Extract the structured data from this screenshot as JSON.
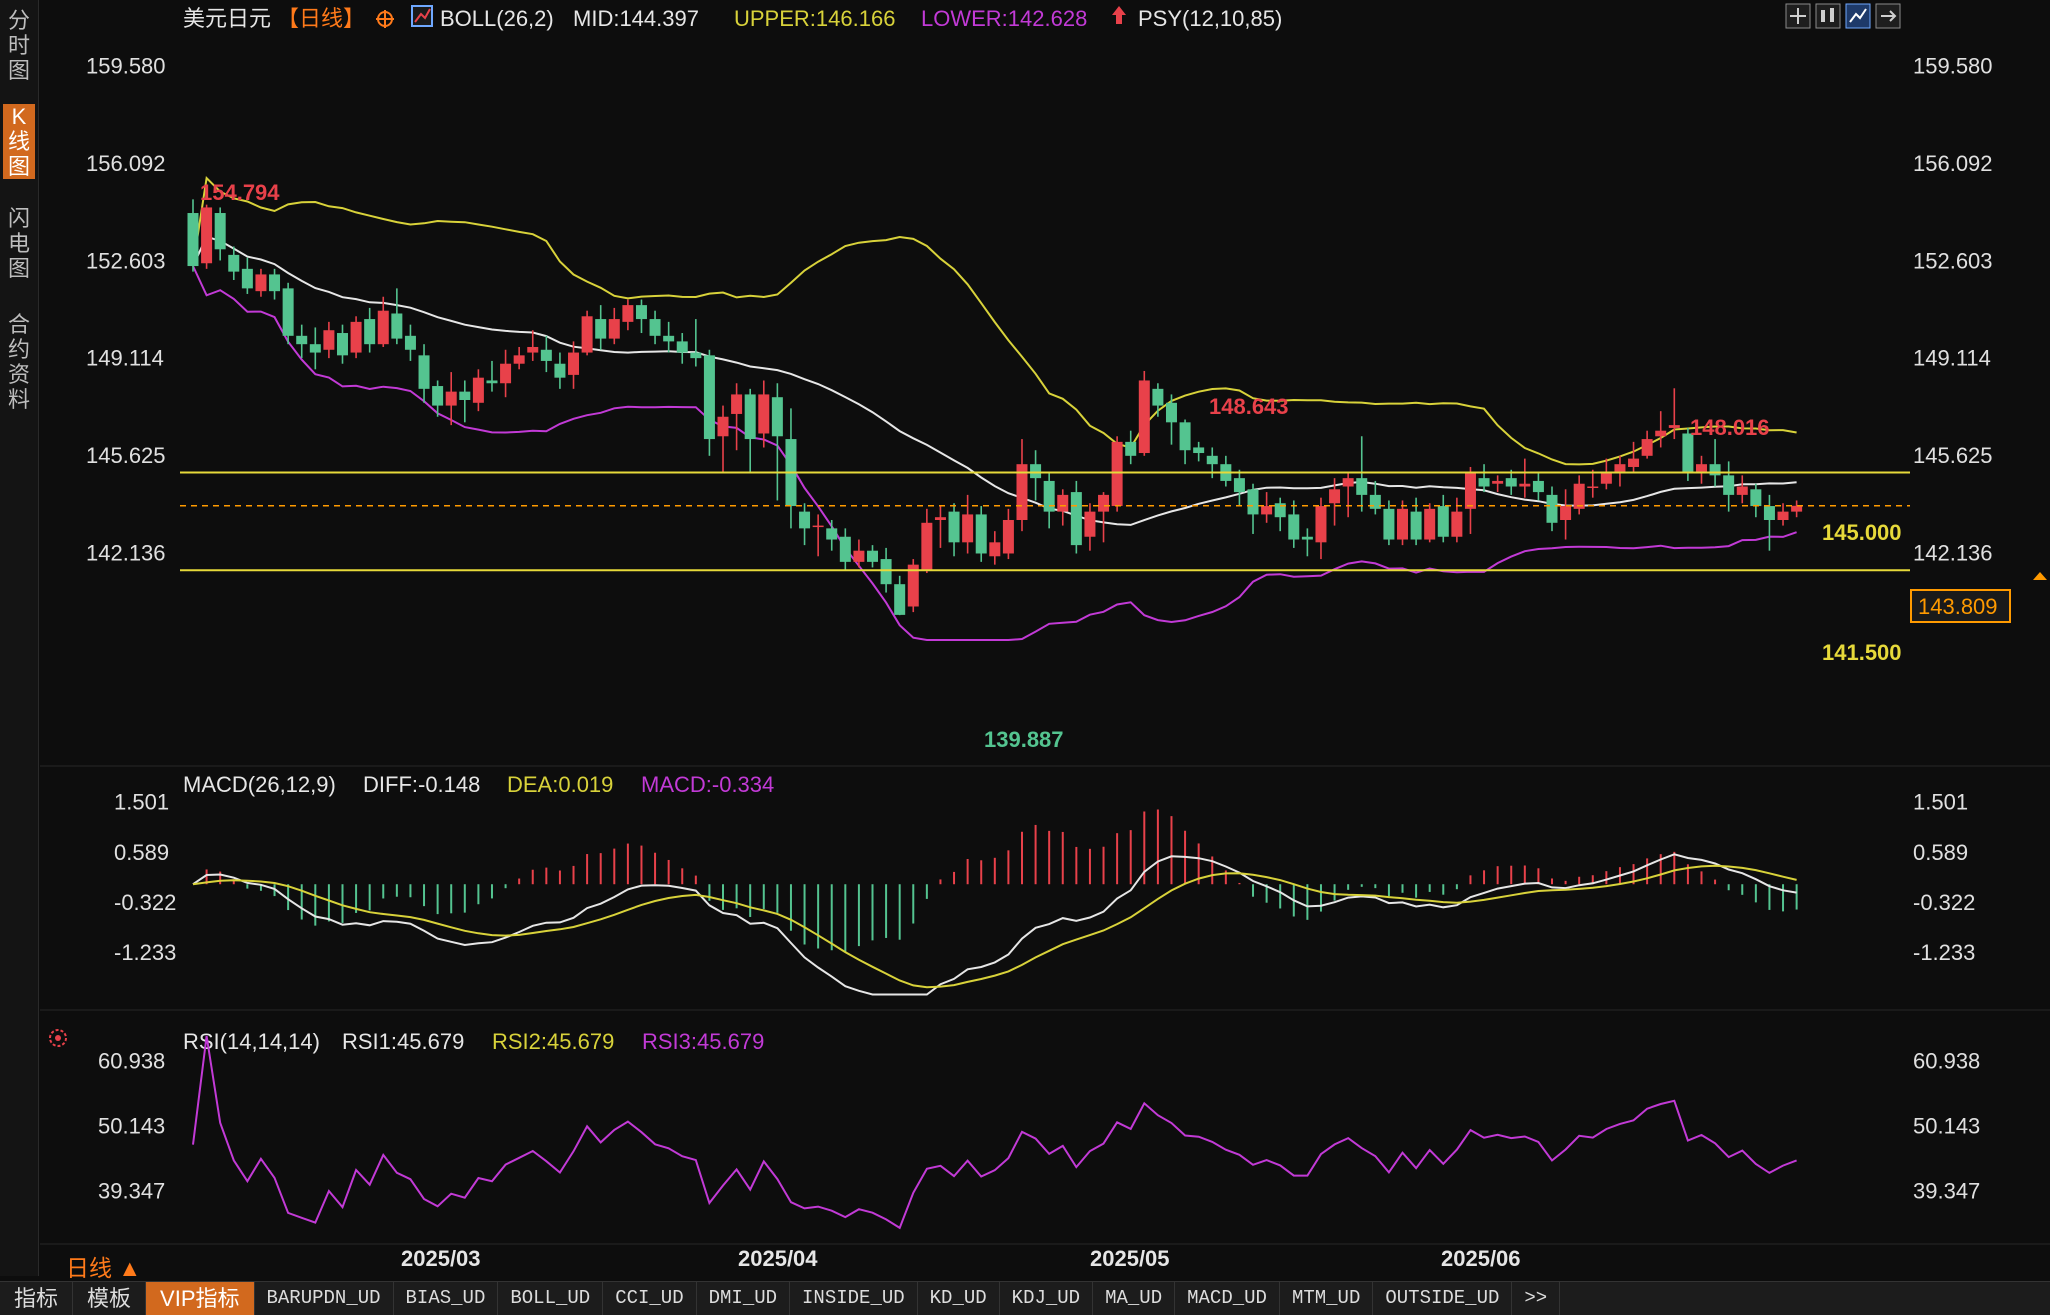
{
  "sidebar": {
    "tabs": [
      {
        "label": "分时图",
        "active": false
      },
      {
        "label": "K线图",
        "active": true
      },
      {
        "label": "闪电图",
        "active": false
      },
      {
        "label": "合约资料",
        "active": false
      }
    ]
  },
  "header": {
    "symbol": "美元日元",
    "period_tag": "【日线】",
    "boll_label": "BOLL(26,2)",
    "mid": "MID:144.397",
    "upper": "UPPER:146.166",
    "lower": "LOWER:142.628",
    "psy": "PSY(12,10,85)"
  },
  "price_axis": {
    "ticks": [
      "159.580",
      "156.092",
      "152.603",
      "149.114",
      "145.625",
      "142.136"
    ],
    "current_price": "143.809"
  },
  "annotations": {
    "high1": "154.794",
    "high2": "148.643",
    "high3": "148.016",
    "low1": "139.887",
    "level_upper": "145.000",
    "level_lower": "141.500"
  },
  "macd": {
    "label": "MACD(26,12,9)",
    "diff": "DIFF:-0.148",
    "dea": "DEA:0.019",
    "macd": "MACD:-0.334",
    "ticks": [
      "1.501",
      "0.589",
      "-0.322",
      "-1.233"
    ]
  },
  "rsi": {
    "label": "RSI(14,14,14)",
    "rsi1": "RSI1:45.679",
    "rsi2": "RSI2:45.679",
    "rsi3": "RSI3:45.679",
    "ticks": [
      "60.938",
      "50.143",
      "39.347"
    ]
  },
  "time_axis": [
    "2025/03",
    "2025/04",
    "2025/05",
    "2025/06"
  ],
  "period_label": "日线 ▲",
  "bottom_tabs": [
    {
      "label": "指标",
      "active": false
    },
    {
      "label": "模板",
      "active": false
    },
    {
      "label": "VIP指标",
      "active": true
    },
    {
      "label": "BARUPDN_UD",
      "active": false
    },
    {
      "label": "BIAS_UD",
      "active": false
    },
    {
      "label": "BOLL_UD",
      "active": false
    },
    {
      "label": "CCI_UD",
      "active": false
    },
    {
      "label": "DMI_UD",
      "active": false
    },
    {
      "label": "INSIDE_UD",
      "active": false
    },
    {
      "label": "KD_UD",
      "active": false
    },
    {
      "label": "KDJ_UD",
      "active": false
    },
    {
      "label": "MA_UD",
      "active": false
    },
    {
      "label": "MACD_UD",
      "active": false
    },
    {
      "label": "MTM_UD",
      "active": false
    },
    {
      "label": "OUTSIDE_UD",
      "active": false
    },
    {
      "label": ">>",
      "active": false
    }
  ],
  "colors": {
    "up": "#e8414a",
    "down": "#54c490",
    "upper_band": "#d8d23a",
    "mid_band": "#e6e6e6",
    "lower_band": "#c23ad6",
    "level_line": "#e6d93a",
    "current_price": "#ff9a00",
    "accent": "#d2691e"
  },
  "chart_data": [
    {
      "type": "candlestick",
      "title": "美元日元 日线",
      "x_ticks": [
        "2025/03",
        "2025/04",
        "2025/05",
        "2025/06"
      ],
      "ylim": [
        139.0,
        160.5
      ],
      "y_ticks": [
        159.58,
        156.092,
        152.603,
        149.114,
        145.625,
        142.136
      ],
      "candles": [
        [
          154.3,
          152.4,
          154.79,
          152.2
        ],
        [
          152.5,
          154.5,
          154.6,
          152.3
        ],
        [
          154.3,
          153.0,
          154.5,
          152.6
        ],
        [
          152.8,
          152.2,
          153.1,
          151.9
        ],
        [
          152.3,
          151.6,
          152.7,
          151.4
        ],
        [
          151.5,
          152.1,
          152.3,
          151.3
        ],
        [
          152.1,
          151.5,
          152.3,
          151.2
        ],
        [
          151.6,
          149.9,
          151.8,
          149.6
        ],
        [
          149.9,
          149.6,
          150.3,
          149.1
        ],
        [
          149.6,
          149.3,
          150.2,
          148.7
        ],
        [
          149.4,
          150.1,
          150.4,
          149.1
        ],
        [
          150.0,
          149.2,
          150.3,
          148.9
        ],
        [
          149.3,
          150.4,
          150.6,
          149.1
        ],
        [
          150.5,
          149.6,
          150.9,
          149.3
        ],
        [
          149.6,
          150.8,
          151.3,
          149.5
        ],
        [
          150.7,
          149.8,
          151.6,
          149.6
        ],
        [
          149.9,
          149.4,
          150.3,
          149.0
        ],
        [
          149.2,
          148.0,
          149.6,
          147.5
        ],
        [
          148.1,
          147.4,
          148.3,
          147.0
        ],
        [
          147.4,
          147.9,
          148.6,
          146.7
        ],
        [
          147.9,
          147.6,
          148.3,
          146.8
        ],
        [
          147.5,
          148.4,
          148.7,
          147.2
        ],
        [
          148.3,
          148.2,
          149.0,
          147.9
        ],
        [
          148.2,
          148.9,
          149.4,
          147.7
        ],
        [
          148.9,
          149.2,
          149.5,
          148.7
        ],
        [
          149.3,
          149.5,
          150.1,
          149.0
        ],
        [
          149.4,
          149.0,
          149.9,
          148.6
        ],
        [
          148.9,
          148.4,
          149.3,
          148.0
        ],
        [
          148.5,
          149.3,
          149.7,
          148.0
        ],
        [
          149.3,
          150.6,
          150.8,
          149.2
        ],
        [
          150.5,
          149.8,
          151.0,
          149.4
        ],
        [
          149.8,
          150.5,
          150.9,
          149.6
        ],
        [
          150.4,
          151.0,
          151.2,
          150.1
        ],
        [
          151.0,
          150.5,
          151.2,
          150.0
        ],
        [
          150.5,
          149.9,
          150.8,
          149.6
        ],
        [
          149.9,
          149.7,
          150.4,
          149.3
        ],
        [
          149.7,
          149.3,
          150.0,
          148.9
        ],
        [
          149.3,
          149.1,
          150.5,
          148.8
        ],
        [
          149.2,
          146.2,
          149.4,
          145.6
        ],
        [
          146.3,
          147.0,
          147.4,
          145.0
        ],
        [
          147.1,
          147.8,
          148.2,
          145.8
        ],
        [
          147.8,
          146.2,
          148.0,
          145.0
        ],
        [
          146.4,
          147.8,
          148.3,
          145.9
        ],
        [
          147.7,
          146.3,
          148.2,
          144.0
        ],
        [
          146.2,
          143.8,
          147.3,
          143.0
        ],
        [
          143.6,
          143.0,
          143.9,
          142.4
        ],
        [
          143.1,
          143.1,
          143.5,
          142.0
        ],
        [
          143.0,
          142.6,
          143.3,
          142.2
        ],
        [
          142.7,
          141.8,
          143.0,
          141.5
        ],
        [
          141.8,
          142.2,
          142.6,
          141.6
        ],
        [
          142.2,
          141.8,
          142.4,
          141.6
        ],
        [
          141.9,
          141.0,
          142.3,
          140.7
        ],
        [
          141.0,
          139.9,
          141.3,
          139.89
        ],
        [
          140.2,
          141.7,
          141.9,
          140.0
        ],
        [
          141.5,
          143.2,
          143.7,
          141.4
        ],
        [
          143.3,
          143.4,
          143.8,
          142.3
        ],
        [
          143.6,
          142.5,
          143.9,
          142.0
        ],
        [
          142.5,
          143.5,
          144.2,
          142.1
        ],
        [
          143.5,
          142.1,
          143.8,
          141.8
        ],
        [
          142.0,
          142.5,
          142.9,
          141.7
        ],
        [
          142.1,
          143.3,
          143.7,
          141.9
        ],
        [
          143.3,
          145.3,
          146.2,
          142.9
        ],
        [
          145.3,
          144.8,
          145.8,
          144.0
        ],
        [
          144.7,
          143.6,
          145.0,
          143.0
        ],
        [
          143.6,
          144.2,
          144.4,
          143.1
        ],
        [
          144.3,
          142.4,
          144.7,
          142.1
        ],
        [
          142.7,
          143.6,
          143.9,
          142.2
        ],
        [
          143.6,
          144.2,
          144.3,
          142.5
        ],
        [
          143.8,
          146.1,
          146.3,
          143.6
        ],
        [
          146.1,
          145.6,
          146.5,
          145.3
        ],
        [
          145.7,
          148.3,
          148.64,
          145.6
        ],
        [
          148.0,
          147.4,
          148.2,
          147.0
        ],
        [
          147.5,
          146.8,
          147.8,
          146.0
        ],
        [
          146.8,
          145.8,
          146.9,
          145.3
        ],
        [
          145.9,
          145.7,
          146.1,
          145.4
        ],
        [
          145.6,
          145.3,
          145.9,
          144.8
        ],
        [
          145.3,
          144.7,
          145.6,
          144.5
        ],
        [
          144.8,
          144.3,
          145.1,
          143.8
        ],
        [
          144.4,
          143.5,
          144.6,
          142.8
        ],
        [
          143.5,
          143.8,
          144.3,
          143.2
        ],
        [
          143.9,
          143.4,
          144.1,
          142.9
        ],
        [
          143.5,
          142.6,
          144.0,
          142.3
        ],
        [
          142.7,
          142.6,
          143.0,
          142.0
        ],
        [
          142.5,
          143.8,
          144.1,
          141.9
        ],
        [
          143.9,
          144.4,
          144.8,
          143.1
        ],
        [
          144.5,
          144.8,
          145.0,
          143.4
        ],
        [
          144.8,
          144.2,
          146.3,
          143.6
        ],
        [
          144.2,
          143.7,
          144.7,
          143.5
        ],
        [
          143.7,
          142.6,
          144.0,
          142.4
        ],
        [
          142.6,
          143.7,
          144.0,
          142.4
        ],
        [
          143.6,
          142.6,
          144.1,
          142.4
        ],
        [
          142.6,
          143.7,
          143.9,
          142.5
        ],
        [
          143.8,
          142.7,
          144.2,
          142.5
        ],
        [
          142.7,
          143.6,
          144.1,
          142.5
        ],
        [
          143.7,
          145.0,
          145.2,
          142.8
        ],
        [
          144.8,
          144.5,
          145.3,
          144.3
        ],
        [
          144.6,
          144.7,
          144.9,
          144.3
        ],
        [
          144.8,
          144.5,
          145.1,
          144.2
        ],
        [
          144.5,
          144.6,
          145.5,
          144.1
        ],
        [
          144.7,
          144.3,
          145.0,
          144.0
        ],
        [
          144.2,
          143.2,
          144.5,
          142.9
        ],
        [
          143.3,
          143.8,
          144.4,
          142.6
        ],
        [
          143.7,
          144.6,
          144.9,
          143.5
        ],
        [
          144.5,
          144.5,
          145.1,
          144.1
        ],
        [
          144.6,
          145.0,
          145.5,
          144.4
        ],
        [
          145.0,
          145.3,
          145.6,
          144.5
        ],
        [
          145.2,
          145.5,
          146.1,
          145.0
        ],
        [
          145.6,
          146.2,
          146.5,
          145.5
        ],
        [
          146.3,
          146.5,
          147.2,
          145.9
        ],
        [
          146.6,
          146.7,
          148.02,
          146.2
        ],
        [
          146.4,
          145.0,
          146.6,
          144.7
        ],
        [
          145.0,
          145.3,
          145.6,
          144.6
        ],
        [
          145.3,
          144.9,
          146.2,
          144.5
        ],
        [
          144.9,
          144.2,
          145.4,
          143.6
        ],
        [
          144.2,
          144.5,
          144.9,
          143.9
        ],
        [
          144.4,
          143.8,
          144.6,
          143.4
        ],
        [
          143.8,
          143.3,
          144.2,
          142.2
        ],
        [
          143.3,
          143.6,
          143.9,
          143.1
        ],
        [
          143.6,
          143.81,
          144.0,
          143.4
        ]
      ]
    },
    {
      "type": "line",
      "title": "MACD(26,12,9)",
      "series": [
        {
          "name": "DIFF",
          "last": -0.148
        },
        {
          "name": "DEA",
          "last": 0.019
        },
        {
          "name": "MACD",
          "last": -0.334
        }
      ],
      "ylim": [
        -2.1,
        1.8
      ],
      "y_ticks": [
        1.501,
        0.589,
        -0.322,
        -1.233
      ]
    },
    {
      "type": "line",
      "title": "RSI(14,14,14)",
      "series": [
        {
          "name": "RSI1",
          "last": 45.679
        },
        {
          "name": "RSI2",
          "last": 45.679
        },
        {
          "name": "RSI3",
          "last": 45.679
        }
      ],
      "ylim": [
        32.0,
        66.0
      ],
      "y_ticks": [
        60.938,
        50.143,
        39.347
      ]
    }
  ]
}
